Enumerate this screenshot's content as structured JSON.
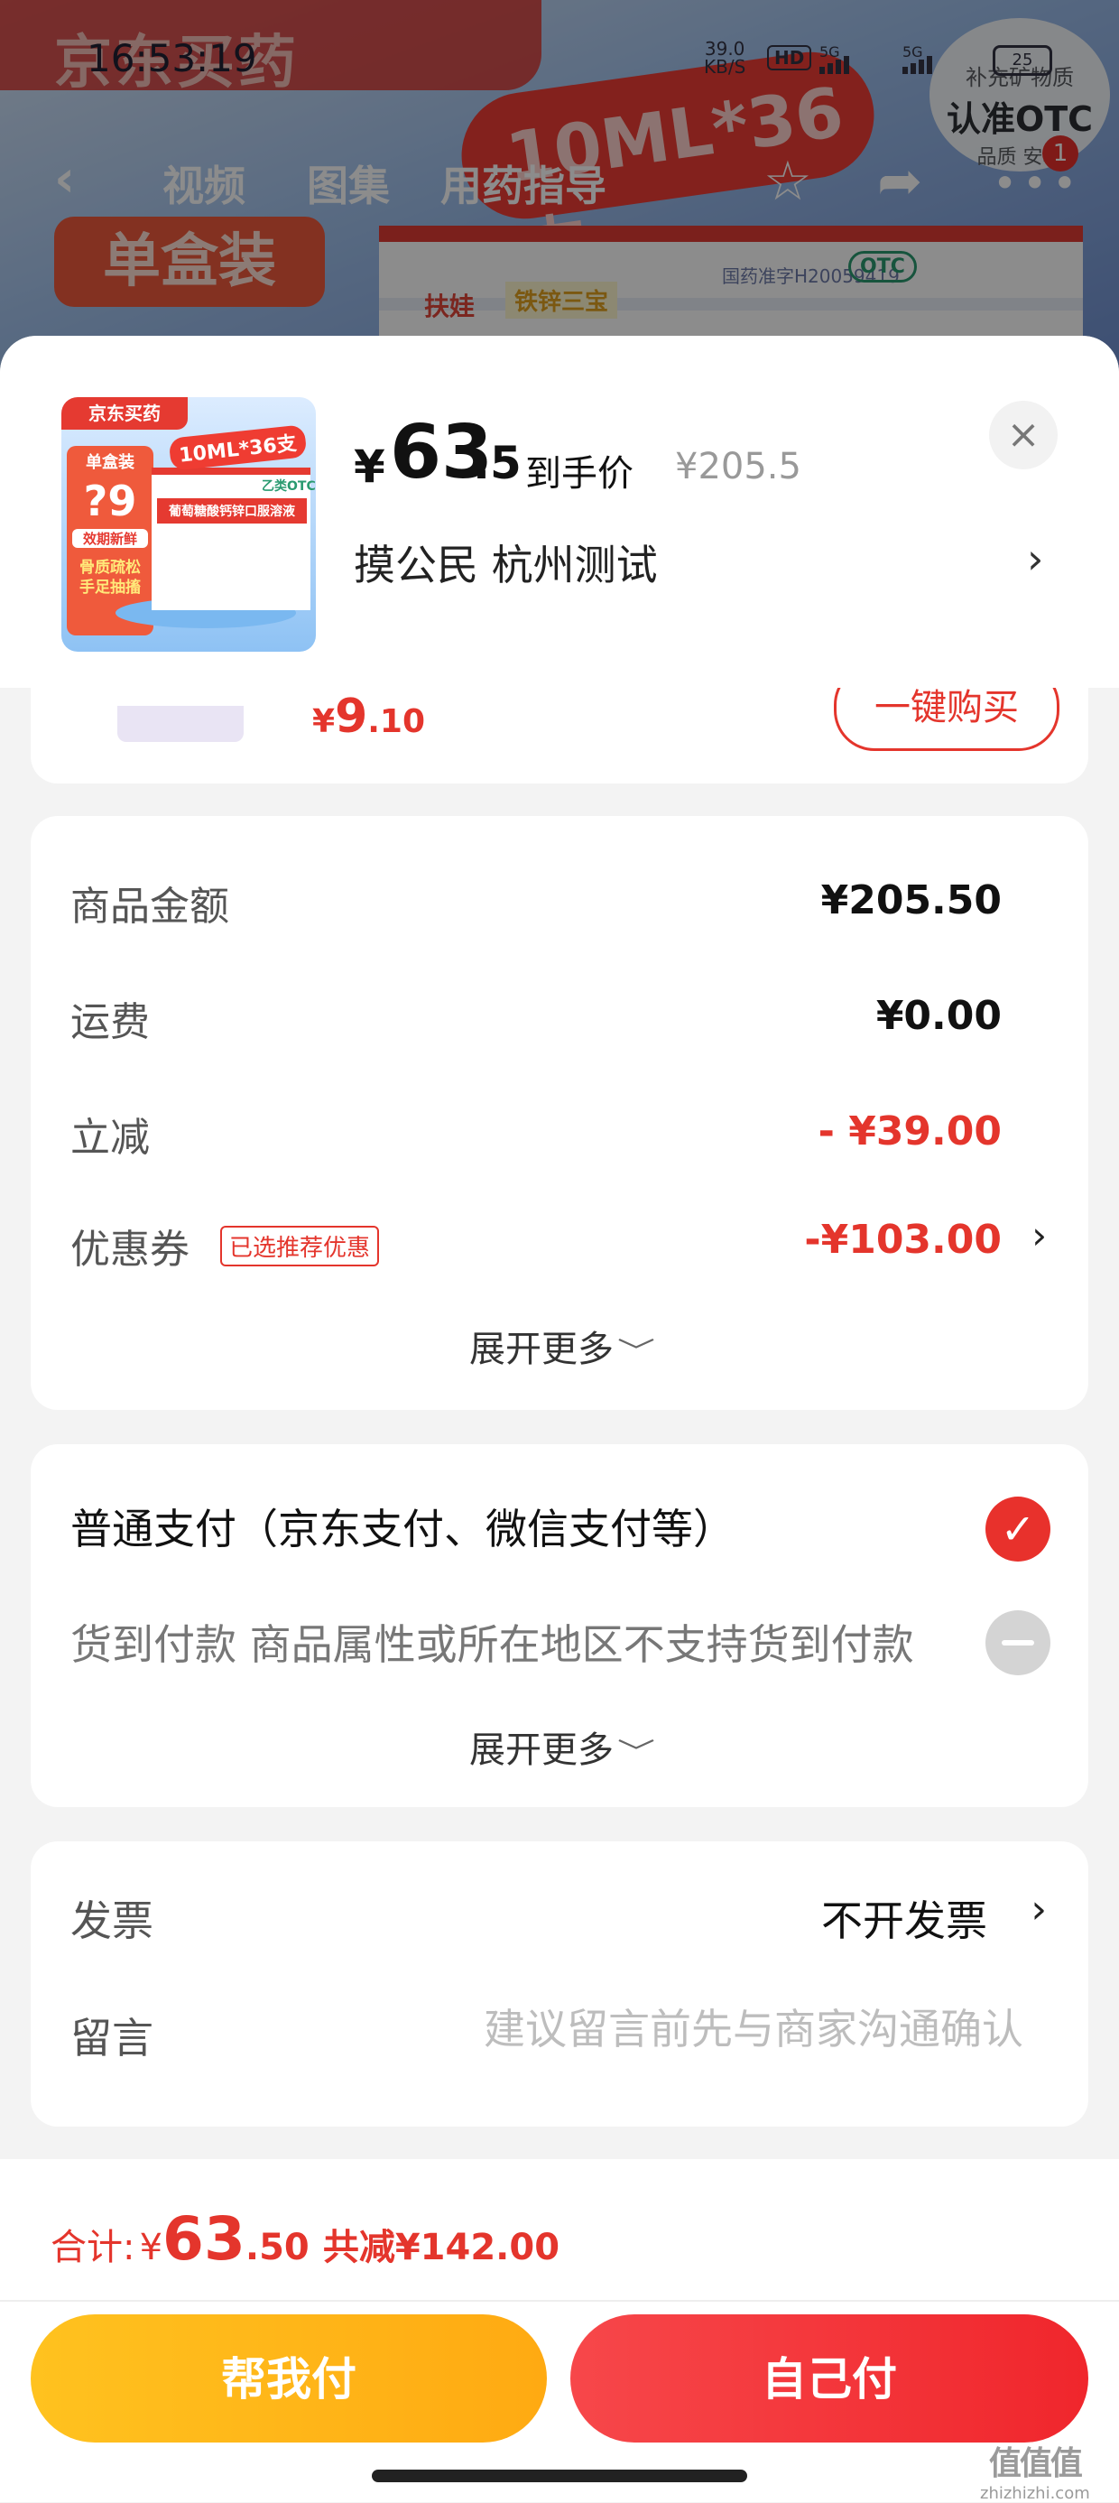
{
  "background": {
    "brand": "京东买药",
    "promo_bubble": "10ML*36支",
    "single_box": "单盒装",
    "box_brand": "扶娃",
    "box_brand2": "铁锌三宝",
    "box_reg": "国药准字H20059419",
    "box_otc": "OTC",
    "otc_badge": {
      "line1": "补充矿物质",
      "line2": "认准OTC",
      "line3": "品质 安心"
    },
    "notification_count": "1",
    "nav_tabs": [
      "视频",
      "图集",
      "用药指导"
    ],
    "status": {
      "time": "16:53:19",
      "speed_value": "39.0",
      "speed_unit": "KB/S",
      "hd": "HD",
      "net1": "5G",
      "net2": "5G",
      "battery": "25"
    }
  },
  "sheet": {
    "thumb": {
      "brand": "京东买药",
      "spec": "10ML*36支",
      "otc": "乙类OTC",
      "name": "葡萄糖酸钙锌口服溶液",
      "single": "单盒装",
      "price": "?9",
      "tag1": "效期新鲜",
      "tag2": "骨质疏松 手足抽搐"
    },
    "price": {
      "currency": "¥",
      "integer": "63",
      "decimal": ".5",
      "label": "到手价",
      "original": "¥205.5"
    },
    "address": "摸公民  杭州测试",
    "close_icon": "×",
    "arrow": "›"
  },
  "recommendation": {
    "price_currency": "¥",
    "price_integer": "9",
    "price_decimal": ".10",
    "button": "一键购买"
  },
  "amounts": {
    "rows": [
      {
        "label": "商品金额",
        "value": "¥205.50"
      },
      {
        "label": "运费",
        "value": "¥0.00"
      },
      {
        "label": "立减",
        "value": "- ¥39.00"
      },
      {
        "label": "优惠券",
        "value": "-¥103.00",
        "tag": "已选推荐优惠"
      }
    ],
    "expand": "展开更多",
    "expand_chevron": "﹀"
  },
  "payment": {
    "normal_label": "普通支付（京东支付、微信支付等）",
    "cod_label": "货到付款 商品属性或所在地区不支持货到付款",
    "expand": "展开更多",
    "check_icon": "✓"
  },
  "invoice": {
    "label": "发票",
    "value": "不开发票",
    "message_label": "留言",
    "message_placeholder": "建议留言前先与商家沟通确认"
  },
  "bottom": {
    "total_label": "合计:",
    "currency": "¥",
    "total_integer": "63",
    "total_decimal": ".50",
    "saved": "共减¥142.00",
    "help_pay": "帮我付",
    "self_pay": "自己付"
  },
  "watermark": {
    "line1": "值值值",
    "line2": "zhizhizhi.com"
  },
  "colors": {
    "accent_red": "#e4352c",
    "pay_yellow": "#ffb414",
    "pay_red": "#f0262c"
  }
}
